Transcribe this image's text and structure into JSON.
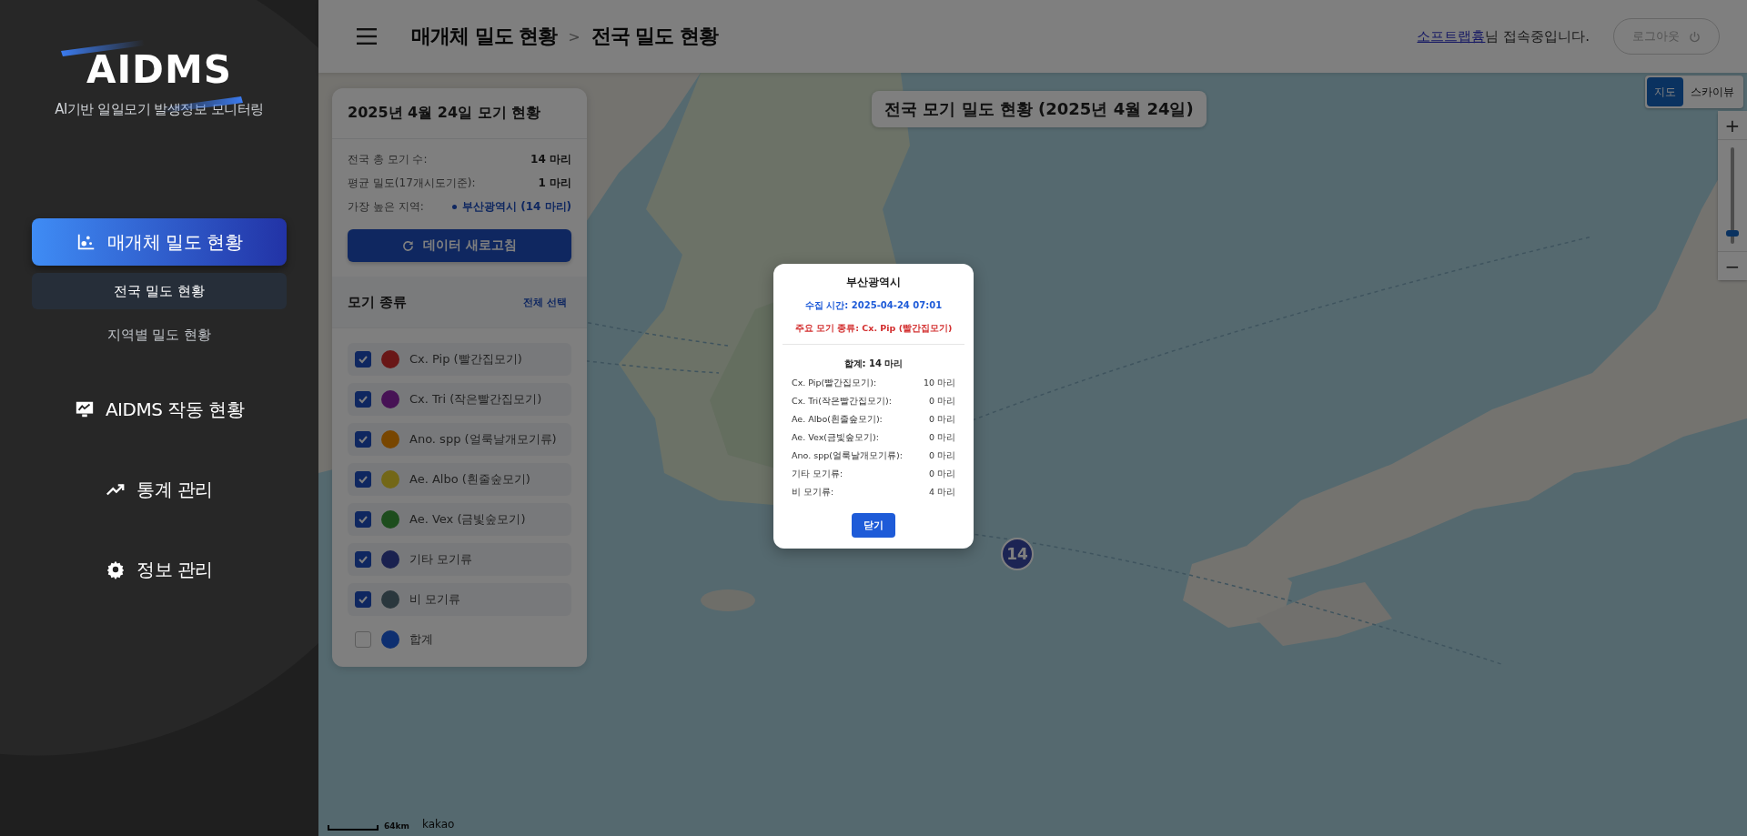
{
  "sidebar": {
    "logo": "AIDMS",
    "subtitle": "AI기반 일일모기 발생정보 모니터링",
    "menu": [
      {
        "label": "매개체 밀도 현황",
        "selected": true,
        "children": [
          {
            "label": "전국 밀도 현황",
            "selected": true
          },
          {
            "label": "지역별 밀도 현황",
            "selected": false
          }
        ]
      },
      {
        "label": "AIDMS 작동 현황",
        "selected": false
      },
      {
        "label": "통계 관리",
        "selected": false
      },
      {
        "label": "정보 관리",
        "selected": false
      }
    ]
  },
  "header": {
    "breadcrumb": [
      "매개체 밀도 현황",
      "전국 밀도 현황"
    ],
    "separator": ">",
    "user": "소프트랩흄",
    "greeting": "님 접속중입니다.",
    "logout": "로그아웃"
  },
  "summary": {
    "title": "2025년 4월 24일 모기 현황",
    "stats": [
      {
        "label": "전국 총 모기 수:",
        "value": "14 마리"
      },
      {
        "label": "평균 밀도(17개시도기준):",
        "value": "1 마리"
      }
    ],
    "highest": {
      "label": "가장 높은 지역:",
      "value": "부산광역시 (14 마리)"
    },
    "refresh": "데이터 새로고침"
  },
  "species_panel": {
    "title": "모기 종류",
    "select_all": "전체 선택",
    "species": [
      {
        "label": "Cx. Pip (빨간집모기)",
        "color": "#691717",
        "checked": true
      },
      {
        "label": "Cx. Tri (작은빨간집모기)",
        "color": "#471255",
        "checked": true
      },
      {
        "label": "Ano. spp (얼룩날개모기류)",
        "color": "#784600",
        "checked": true
      },
      {
        "label": "Ae. Albo (흰줄숲모기)",
        "color": "#736717",
        "checked": true
      },
      {
        "label": "Ae. Vex (금빛숲모기)",
        "color": "#1d4d1d",
        "checked": true
      },
      {
        "label": "기타 모기류",
        "color": "#1a214f",
        "checked": true
      },
      {
        "label": "비 모기류",
        "color": "#2a373d",
        "checked": true
      },
      {
        "label": "합계",
        "color": "#0e2f70",
        "checked": false
      }
    ]
  },
  "map": {
    "title": "전국 모기 밀도 현황 (2025년 4월 24일)",
    "map_types": [
      {
        "label": "지도",
        "selected": true
      },
      {
        "label": "스카이뷰",
        "selected": false
      }
    ],
    "zoom_in": "+",
    "zoom_out": "−",
    "zoom": {
      "level": 0.08
    },
    "marker": "14",
    "scale": "64km",
    "attribution": "kakao"
  },
  "popup": {
    "title": "부산광역시",
    "time": "수집 시간: 2025-04-24 07:01",
    "main_species": "주요 모기 종류: Cx. Pip (빨간집모기)",
    "total": "합계: 14 마리",
    "rows": [
      {
        "label": "Cx. Pip(빨간집모기):",
        "value": "10 마리"
      },
      {
        "label": "Cx. Tri(작은빨간집모기):",
        "value": "0 마리"
      },
      {
        "label": "Ae. Albo(흰줄숲모기):",
        "value": "0 마리"
      },
      {
        "label": "Ae. Vex(금빛숲모기):",
        "value": "0 마리"
      },
      {
        "label": "Ano. spp(얼룩날개모기류):",
        "value": "0 마리"
      },
      {
        "label": "기타 모기류:",
        "value": "0 마리"
      },
      {
        "label": "비 모기류:",
        "value": "4 마리"
      }
    ],
    "close": "닫기"
  }
}
